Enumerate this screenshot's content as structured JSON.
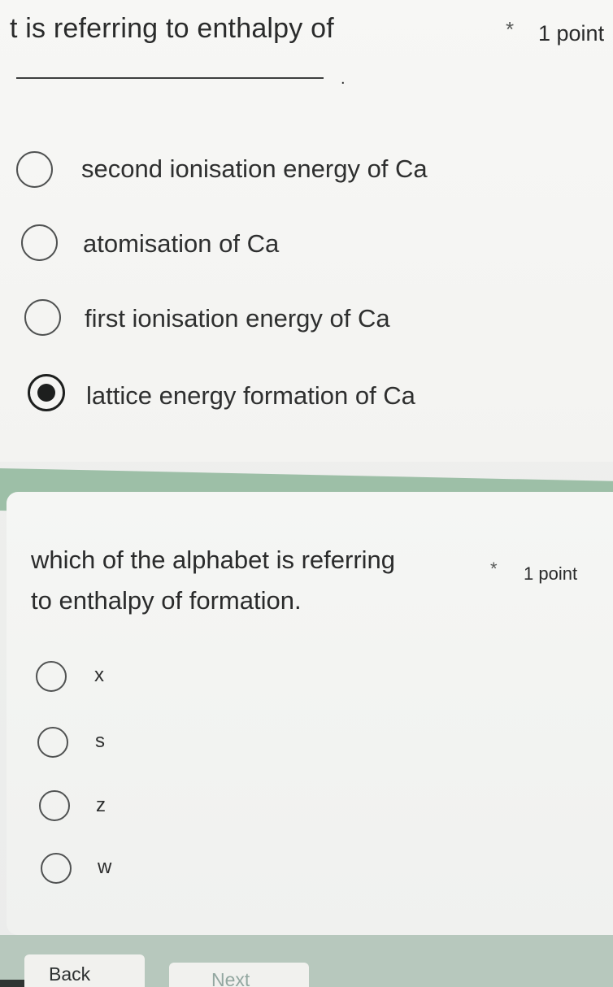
{
  "question1": {
    "title": "t is referring to enthalpy of",
    "required_mark": "*",
    "points": "1 point",
    "blank_suffix": ".",
    "options": [
      {
        "label": "second ionisation energy of Ca",
        "selected": false
      },
      {
        "label": "atomisation of Ca",
        "selected": false
      },
      {
        "label": "first ionisation energy of Ca",
        "selected": false
      },
      {
        "label": "lattice energy formation of Ca",
        "selected": true
      }
    ]
  },
  "question2": {
    "title_line1": "which of the alphabet is referring",
    "title_line2": "to enthalpy of formation.",
    "required_mark": "*",
    "points": "1 point",
    "options": [
      {
        "label": "x",
        "selected": false
      },
      {
        "label": "s",
        "selected": false
      },
      {
        "label": "z",
        "selected": false
      },
      {
        "label": "w",
        "selected": false
      }
    ]
  },
  "nav": {
    "back_label": "Back",
    "next_label": "Next"
  },
  "colors": {
    "section_band": "#9dbfa7",
    "footer_band": "#b7c8bd",
    "text": "#2a2b2b"
  }
}
